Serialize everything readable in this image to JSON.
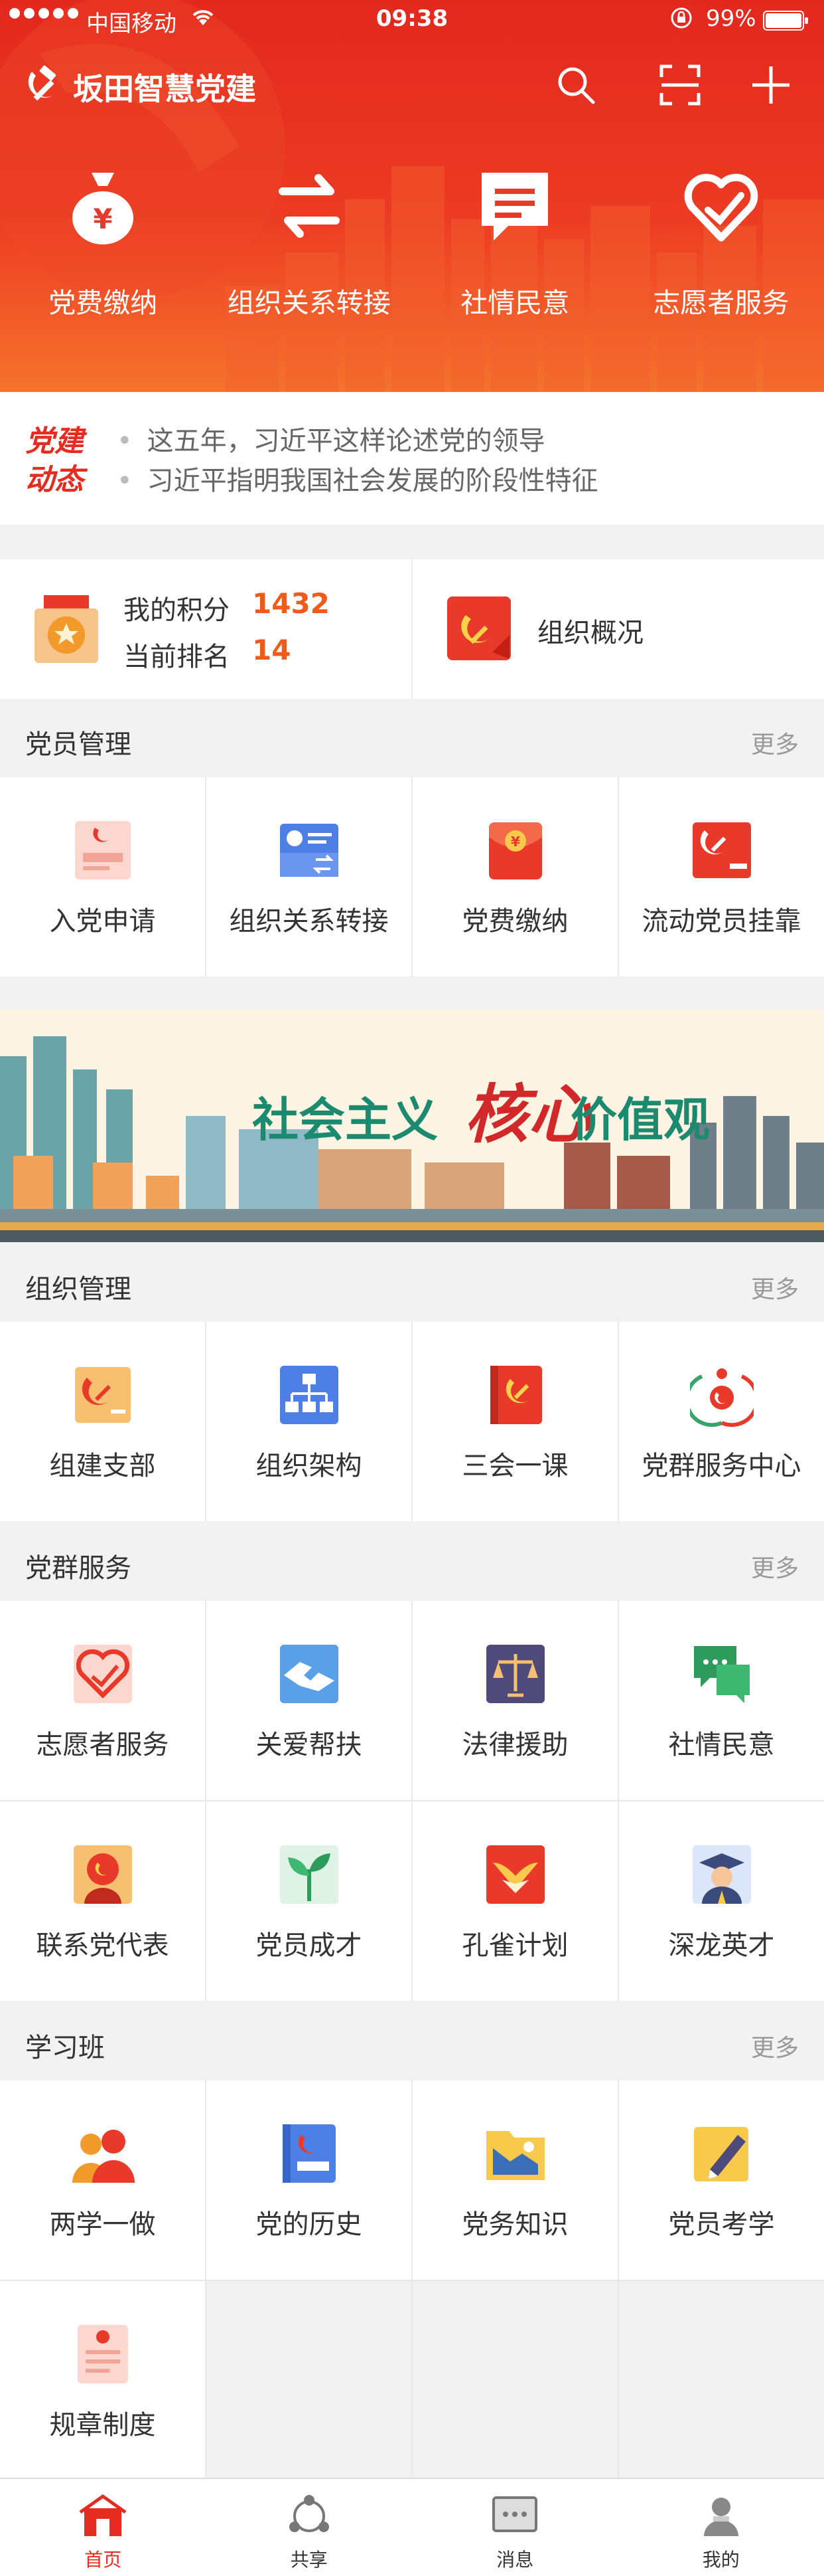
{
  "status_bar": {
    "carrier": "中国移动",
    "time": "09:38",
    "battery": "99%"
  },
  "header": {
    "title": "坂田智慧党建"
  },
  "quick_actions": [
    {
      "label": "党费缴纳",
      "icon": "money-bag-icon"
    },
    {
      "label": "组织关系转接",
      "icon": "transfer-arrows-icon"
    },
    {
      "label": "社情民意",
      "icon": "message-icon"
    },
    {
      "label": "志愿者服务",
      "icon": "heart-hand-icon"
    }
  ],
  "news": {
    "badge_line1": "党建",
    "badge_line2": "动态",
    "items": [
      "这五年，习近平这样论述党的领导",
      "习近平指明我国社会发展的阶段性特征"
    ]
  },
  "score": {
    "points_label": "我的积分",
    "points_value": "1432",
    "rank_label": "当前排名",
    "rank_value": "14",
    "org_label": "组织概况"
  },
  "sections": {
    "member_mgmt": {
      "title": "党员管理",
      "more": "更多",
      "items": [
        "入党申请",
        "组织关系转接",
        "党费缴纳",
        "流动党员挂靠"
      ]
    },
    "org_mgmt": {
      "title": "组织管理",
      "more": "更多",
      "items": [
        "组建支部",
        "组织架构",
        "三会一课",
        "党群服务中心"
      ]
    },
    "party_service": {
      "title": "党群服务",
      "more": "更多",
      "items": [
        "志愿者服务",
        "关爱帮扶",
        "法律援助",
        "社情民意",
        "联系党代表",
        "党员成才",
        "孔雀计划",
        "深龙英才"
      ]
    },
    "study": {
      "title": "学习班",
      "more": "更多",
      "items": [
        "两学一做",
        "党的历史",
        "党务知识",
        "党员考学",
        "规章制度"
      ]
    }
  },
  "banner": {
    "part1": "社会主义",
    "part2": "核心",
    "part3": "价值观"
  },
  "tabbar": [
    "首页",
    "共享",
    "消息",
    "我的"
  ],
  "colors": {
    "primary": "#e62c21",
    "accent_orange": "#f25a1a",
    "background": "#f2f2f2"
  }
}
